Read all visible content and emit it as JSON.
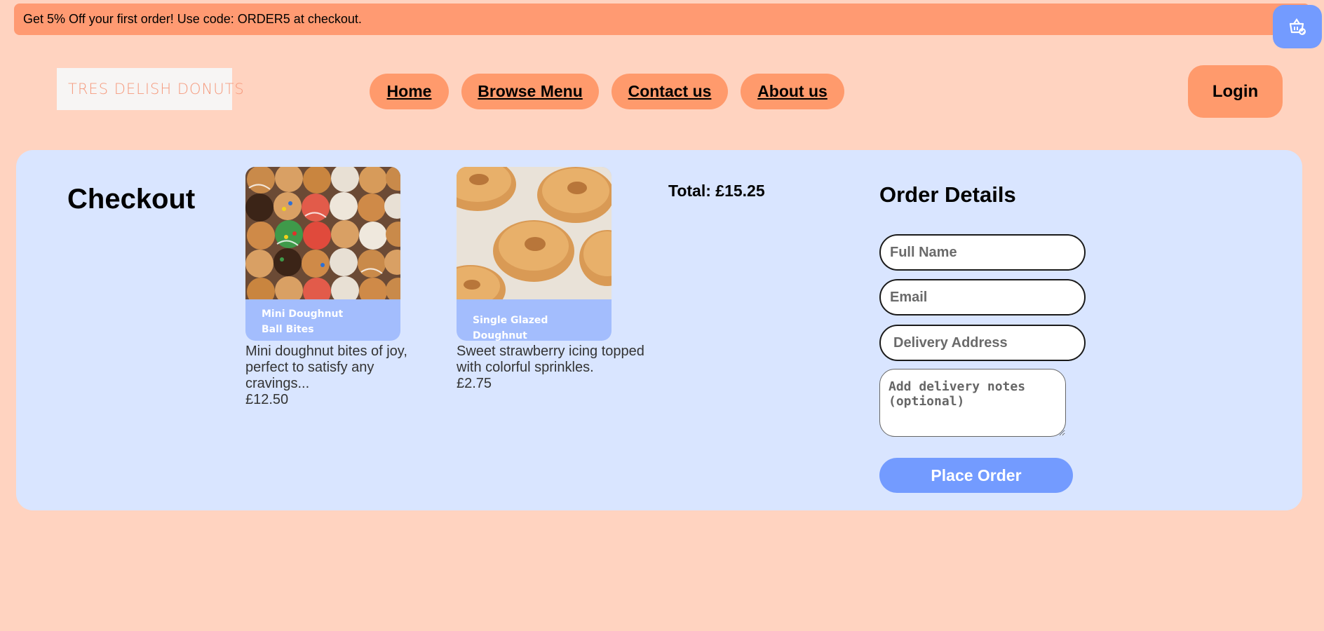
{
  "promo": {
    "text": "Get 5% Off your first order! Use code: ORDER5 at checkout."
  },
  "header": {
    "logo_text": "TRES DELISH DONUTS",
    "nav": [
      {
        "label": "Home"
      },
      {
        "label": "Browse Menu"
      },
      {
        "label": "Contact us"
      },
      {
        "label": "About us"
      }
    ],
    "login_label": "Login"
  },
  "checkout": {
    "title": "Checkout",
    "total": "Total: £15.25",
    "products": [
      {
        "name": "Mini Doughnut Ball Bites",
        "description": "Mini doughnut bites of joy, perfect to satisfy any cravings...",
        "price": "£12.50"
      },
      {
        "name": "Single Glazed Doughnut",
        "description": "Sweet strawberry icing topped with colorful sprinkles.",
        "price": "£2.75"
      }
    ]
  },
  "order_details": {
    "title": "Order Details",
    "full_name_placeholder": "Full Name",
    "email_placeholder": "Email",
    "address_placeholder": "Delivery Address",
    "notes_placeholder": "Add delivery notes (optional)",
    "submit_label": "Place Order"
  },
  "colors": {
    "background": "#ffd3c0",
    "accent_orange": "#ff9a6c",
    "accent_blue": "#739bff",
    "panel_blue": "#d9e5ff"
  },
  "icons": {
    "cart": "basket-check-icon",
    "logo": "donut-icon"
  }
}
